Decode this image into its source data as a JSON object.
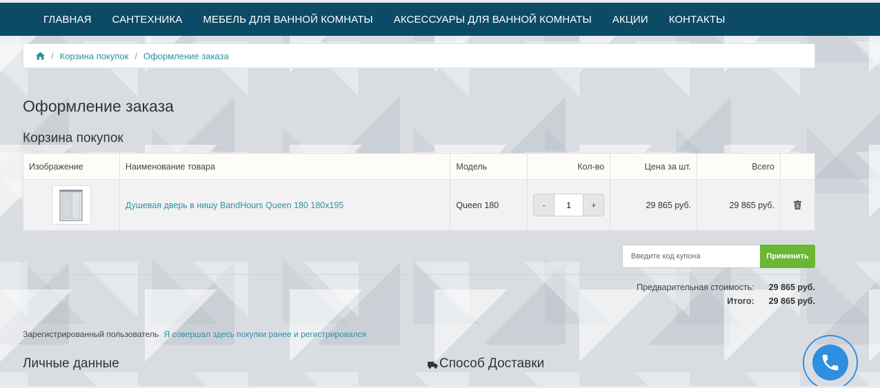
{
  "nav": {
    "items": [
      {
        "label": "ГЛАВНАЯ"
      },
      {
        "label": "САНТЕХНИКА"
      },
      {
        "label": "МЕБЕЛЬ ДЛЯ ВАННОЙ КОМНАТЫ"
      },
      {
        "label": "АКСЕССУАРЫ ДЛЯ ВАННОЙ КОМНАТЫ"
      },
      {
        "label": "АКЦИИ"
      },
      {
        "label": "КОНТАКТЫ"
      }
    ]
  },
  "breadcrumb": {
    "home_icon": "home-icon",
    "items": [
      {
        "label": "Корзина покупок"
      },
      {
        "label": "Оформление заказа"
      }
    ]
  },
  "page_title": "Оформление заказа",
  "cart": {
    "title": "Корзина покупок",
    "columns": [
      "Изображение",
      "Наименование товара",
      "Модель",
      "Кол-во",
      "Цена за шт.",
      "Всего"
    ],
    "rows": [
      {
        "name": "Душевая дверь в нишу BandHours Queen 180 180x195",
        "model": "Queen 180",
        "qty_minus": "-",
        "quantity": "1",
        "qty_plus": "+",
        "price": "29 865 руб.",
        "total": "29 865 руб."
      }
    ]
  },
  "coupon": {
    "placeholder": "Введите код купона",
    "apply_label": "Применить",
    "button_color": "#6bb633"
  },
  "totals": {
    "subtotal_label": "Предварительная стоимость:",
    "subtotal_value": "29 865 руб.",
    "total_label": "Итого:",
    "total_value": "29 865 руб."
  },
  "account": {
    "registered_text": "Зарегистрированный пользователь",
    "login_link": "Я совершал здесь покупки ранее и регистрировался"
  },
  "sections": {
    "personal_title": "Личные данные",
    "delivery_title": "Способ Доставки"
  },
  "colors": {
    "nav_bg": "#0b4b66",
    "link": "#2e8fa5",
    "call_button": "#2e8fe0"
  }
}
